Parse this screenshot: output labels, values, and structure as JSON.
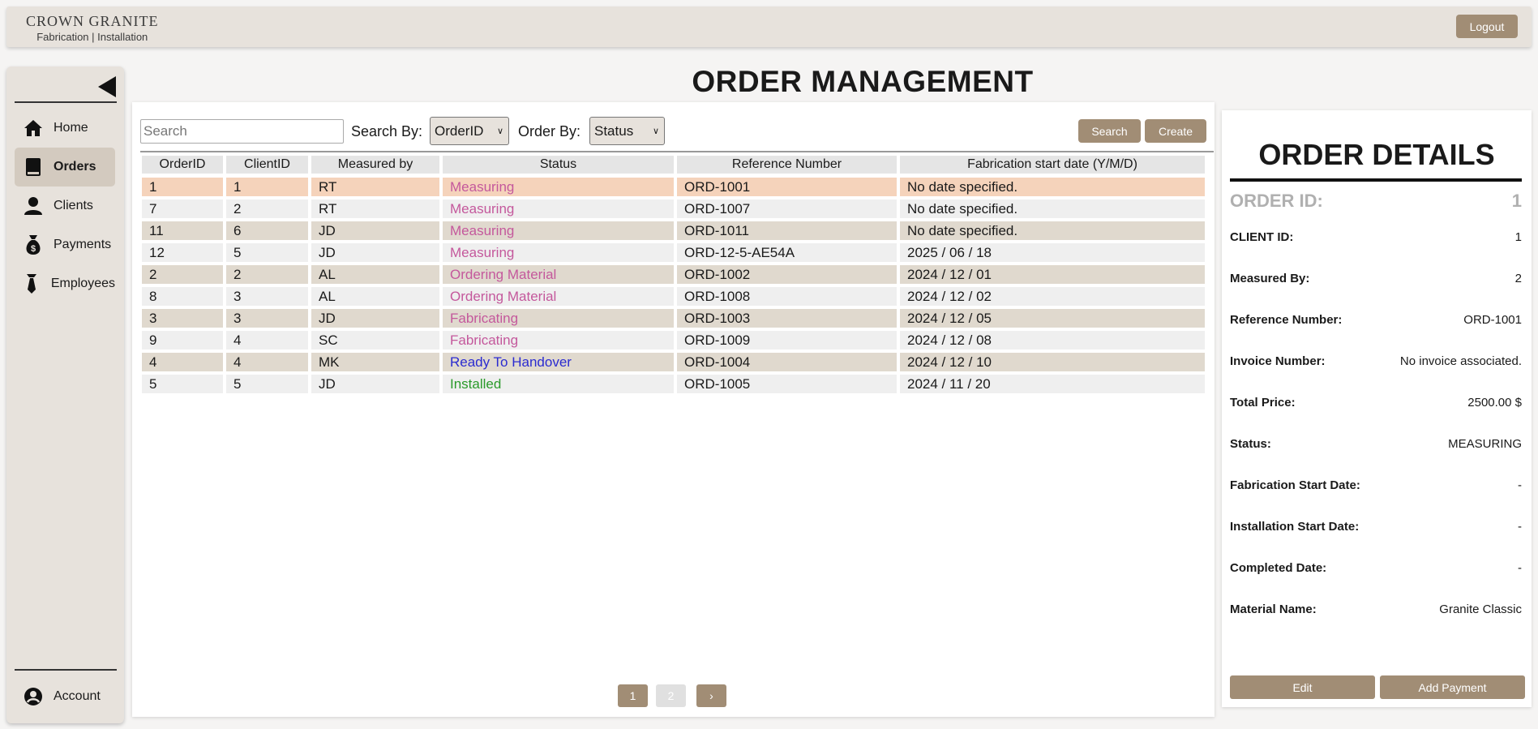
{
  "brand": {
    "name": "CROWN GRANITE",
    "subtitle": "Fabrication | Installation"
  },
  "header": {
    "logout_label": "Logout"
  },
  "sidebar": {
    "items": [
      {
        "label": "Home",
        "icon": "home-icon",
        "active": false
      },
      {
        "label": "Orders",
        "icon": "book-icon",
        "active": true
      },
      {
        "label": "Clients",
        "icon": "user-icon",
        "active": false
      },
      {
        "label": "Payments",
        "icon": "money-bag-icon",
        "active": false
      },
      {
        "label": "Employees",
        "icon": "tie-icon",
        "active": false
      }
    ],
    "account_label": "Account"
  },
  "page": {
    "title": "ORDER MANAGEMENT"
  },
  "toolbar": {
    "search_placeholder": "Search",
    "search_by_label": "Search By:",
    "search_by_value": "OrderID",
    "order_by_label": "Order By:",
    "order_by_value": "Status",
    "search_button": "Search",
    "create_button": "Create"
  },
  "table": {
    "columns": [
      "OrderID",
      "ClientID",
      "Measured by",
      "Status",
      "Reference Number",
      "Fabrication start date (Y/M/D)"
    ],
    "rows": [
      [
        "1",
        "1",
        "RT",
        "Measuring",
        "ORD-1001",
        "No date specified."
      ],
      [
        "7",
        "2",
        "RT",
        "Measuring",
        "ORD-1007",
        "No date specified."
      ],
      [
        "11",
        "6",
        "JD",
        "Measuring",
        "ORD-1011",
        "No date specified."
      ],
      [
        "12",
        "5",
        "JD",
        "Measuring",
        "ORD-12-5-AE54A",
        "2025 / 06 / 18"
      ],
      [
        "2",
        "2",
        "AL",
        "Ordering Material",
        "ORD-1002",
        "2024 / 12 / 01"
      ],
      [
        "8",
        "3",
        "AL",
        "Ordering Material",
        "ORD-1008",
        "2024 / 12 / 02"
      ],
      [
        "3",
        "3",
        "JD",
        "Fabricating",
        "ORD-1003",
        "2024 / 12 / 05"
      ],
      [
        "9",
        "4",
        "SC",
        "Fabricating",
        "ORD-1009",
        "2024 / 12 / 08"
      ],
      [
        "4",
        "4",
        "MK",
        "Ready To Handover",
        "ORD-1004",
        "2024 / 12 / 10"
      ],
      [
        "5",
        "5",
        "JD",
        "Installed",
        "ORD-1005",
        "2024 / 11 / 20"
      ]
    ],
    "status_colors": {
      "Measuring": "#c4589c",
      "Ordering Material": "#c4589c",
      "Fabricating": "#c4589c",
      "Ready To Handover": "#2b2bd0",
      "Installed": "#2a9a2a"
    }
  },
  "pagination": {
    "page1": "1",
    "page2": "2",
    "next": "›"
  },
  "details": {
    "title": "ORDER DETAILS",
    "order_id_label": "ORDER ID:",
    "order_id_value": "1",
    "fields": [
      {
        "label": "CLIENT ID:",
        "value": "1"
      },
      {
        "label": "Measured By:",
        "value": "2"
      },
      {
        "label": "Reference Number:",
        "value": "ORD-1001"
      },
      {
        "label": "Invoice Number:",
        "value": "No invoice associated."
      },
      {
        "label": "Total Price:",
        "value": "2500.00 $"
      },
      {
        "label": "Status:",
        "value": "MEASURING"
      },
      {
        "label": "Fabrication Start Date:",
        "value": "-"
      },
      {
        "label": "Installation Start Date:",
        "value": "-"
      },
      {
        "label": "Completed Date:",
        "value": "-"
      },
      {
        "label": "Material Name:",
        "value": "Granite Classic"
      }
    ],
    "edit_button": "Edit",
    "add_payment_button": "Add Payment"
  },
  "colors": {
    "accent": "#a18d75",
    "panel": "#e7e2dc",
    "selected_row": "#f5d3bb",
    "alt_row": "#e0d9ce"
  }
}
